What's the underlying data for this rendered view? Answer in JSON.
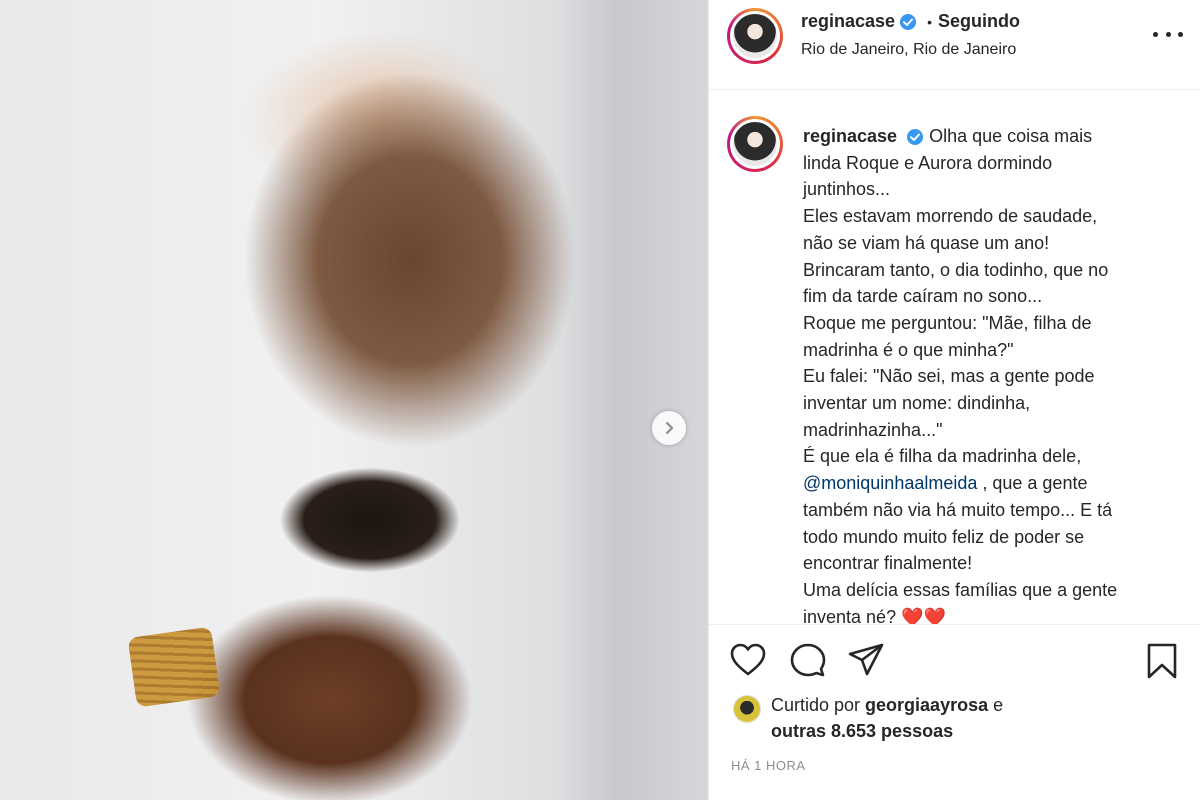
{
  "post": {
    "author": "reginacase",
    "follow_state": "Seguindo",
    "location": "Rio de Janeiro, Rio de Janeiro"
  },
  "caption": {
    "username": "reginacase",
    "lines": [
      "Olha que coisa mais",
      "linda Roque e Aurora dormindo",
      "juntinhos...",
      "Eles estavam morrendo de saudade,",
      "não se viam há quase um ano!",
      "Brincaram tanto, o dia todinho, que no",
      "fim da tarde caíram no sono...",
      "Roque me perguntou: \"Mãe, filha de",
      "madrinha é o que minha?\"",
      "Eu falei: \"Não sei, mas a gente pode",
      "inventar um nome: dindinha,",
      "madrinhazinha...\"",
      "É que ela é filha da madrinha dele,"
    ],
    "mention": "@moniquinhaalmeida",
    "after_mention": " , que a gente",
    "lines2": [
      "também não via há muito tempo... E tá",
      "todo mundo muito feliz de poder se",
      "encontrar finalmente!",
      "Uma delícia essas famílias que a gente",
      "inventa né?"
    ],
    "emoji": "❤️❤️"
  },
  "likes": {
    "prefix": "Curtido por ",
    "liker": "georgiaayrosa",
    "connector": " e",
    "others": "outras 8.653 pessoas"
  },
  "timestamp": "HÁ 1 HORA",
  "icons": {
    "verified": "verified-badge-icon",
    "more": "more-options-icon",
    "like": "heart-icon",
    "comment": "comment-icon",
    "share": "paper-plane-icon",
    "save": "bookmark-icon",
    "next": "chevron-right-icon"
  },
  "colors": {
    "verified_blue": "#3897f0",
    "mention_link": "#00376b",
    "muted_text": "#8e8e8e"
  }
}
